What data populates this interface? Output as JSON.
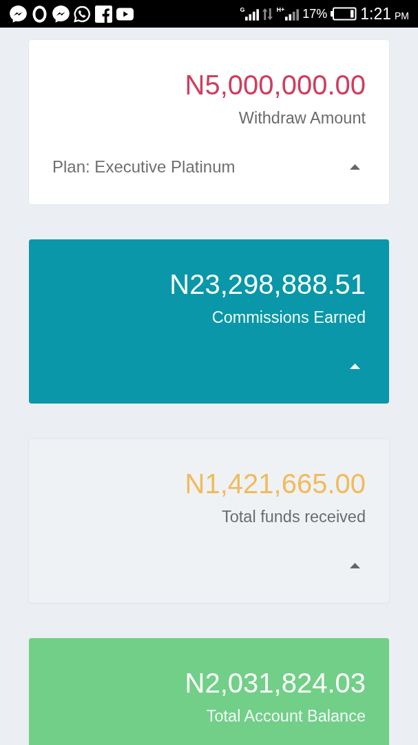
{
  "status_bar": {
    "signals": [
      {
        "network": "G"
      },
      {
        "network": "H+"
      }
    ],
    "battery_percent": "17%",
    "time": "1:21",
    "meridiem": "PM"
  },
  "cards": [
    {
      "kind": "light",
      "color": "#cf3d5e",
      "amount": "N5,000,000.00",
      "label": "Withdraw Amount",
      "plan": "Plan: Executive Platinum",
      "toggle": true
    },
    {
      "kind": "filled",
      "color": "#0997a9",
      "amount": "N23,298,888.51",
      "label": "Commissions Earned",
      "toggle": true
    },
    {
      "kind": "flat",
      "color": "#f0bb5c",
      "amount": "N1,421,665.00",
      "label": "Total funds received",
      "toggle": true
    },
    {
      "kind": "filled",
      "color": "#72cf87",
      "amount": "N2,031,824.03",
      "label": "Total Account Balance"
    }
  ]
}
